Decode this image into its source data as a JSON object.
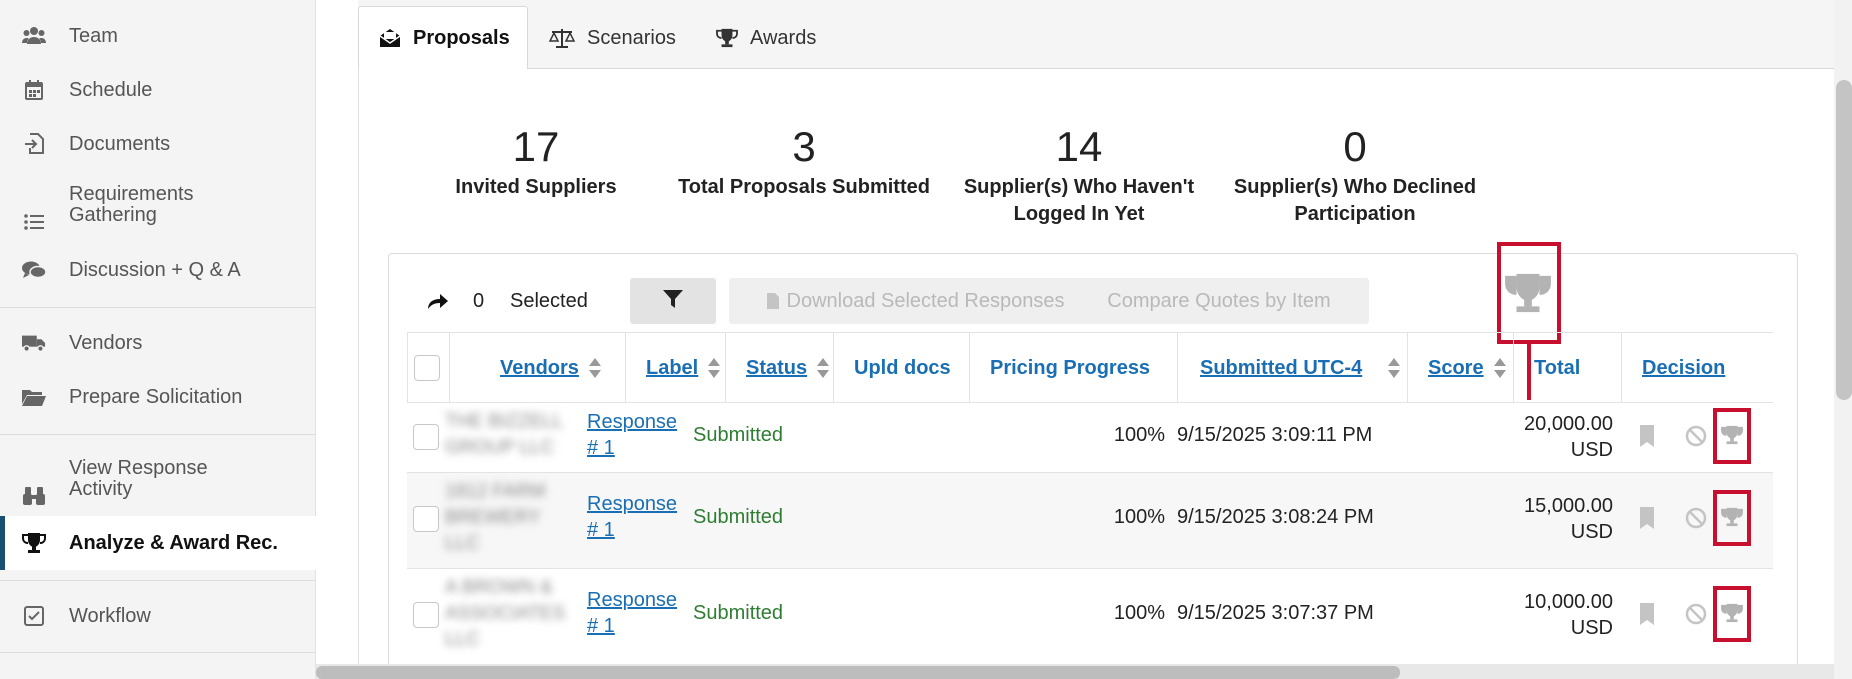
{
  "sidebar": {
    "items": [
      {
        "label": "Team",
        "icon": "team-icon"
      },
      {
        "label": "Schedule",
        "icon": "calendar-icon"
      },
      {
        "label": "Documents",
        "icon": "document-import-icon"
      },
      {
        "label": "Requirements Gathering",
        "icon": "list-icon"
      },
      {
        "label": "Discussion + Q & A",
        "icon": "comments-icon"
      },
      {
        "label": "Vendors",
        "icon": "truck-icon"
      },
      {
        "label": "Prepare Solicitation",
        "icon": "folder-open-icon"
      },
      {
        "label": "View Response Activity",
        "icon": "binoculars-icon"
      },
      {
        "label": "Analyze & Award Rec.",
        "icon": "trophy-icon"
      },
      {
        "label": "Workflow",
        "icon": "checkbox-icon"
      }
    ]
  },
  "tabs": [
    {
      "label": "Proposals",
      "icon": "envelope-open-icon"
    },
    {
      "label": "Scenarios",
      "icon": "scale-icon"
    },
    {
      "label": "Awards",
      "icon": "trophy-icon"
    }
  ],
  "stats": [
    {
      "value": "17",
      "caption": "Invited Suppliers"
    },
    {
      "value": "3",
      "caption": "Total Proposals Submitted"
    },
    {
      "value": "14",
      "caption": "Supplier(s) Who Haven't Logged In Yet"
    },
    {
      "value": "0",
      "caption": "Supplier(s) Who Declined Participation"
    }
  ],
  "toolbar": {
    "selected_count": "0",
    "selected_label": "Selected",
    "download_label": "Download Selected Responses",
    "compare_label": "Compare Quotes by Item"
  },
  "table": {
    "headers": {
      "vendors": "Vendors",
      "label": "Label",
      "status": "Status",
      "upld_docs": "Upld docs",
      "pricing_progress": "Pricing Progress",
      "submitted": "Submitted UTC-4",
      "score": "Score",
      "total": "Total",
      "decision": "Decision"
    },
    "rows": [
      {
        "vendor": "THE BIZZELL GROUP LLC",
        "label_line1": "Response",
        "label_line2": "# 1",
        "status": "Submitted",
        "pricing": "100%",
        "submitted": "9/15/2025 3:09:11 PM",
        "total_amount": "20,000.00",
        "total_currency": "USD"
      },
      {
        "vendor": "1812 FARM BREWERY LLC",
        "label_line1": "Response",
        "label_line2": "# 1",
        "status": "Submitted",
        "pricing": "100%",
        "submitted": "9/15/2025 3:08:24 PM",
        "total_amount": "15,000.00",
        "total_currency": "USD"
      },
      {
        "vendor": "A BROWN & ASSOCIATES LLC",
        "label_line1": "Response",
        "label_line2": "# 1",
        "status": "Submitted",
        "pricing": "100%",
        "submitted": "9/15/2025 3:07:37 PM",
        "total_amount": "10,000.00",
        "total_currency": "USD"
      }
    ]
  },
  "colors": {
    "link": "#1a6fb4",
    "status_submitted": "#2e7d32",
    "highlight": "#c8102e",
    "active_sidebar_border": "#1b4f72"
  }
}
